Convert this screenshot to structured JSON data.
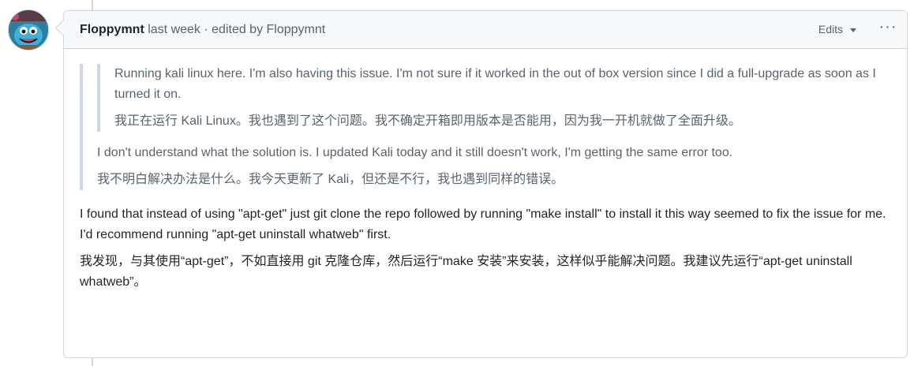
{
  "comment": {
    "author": "Floppymnt",
    "time": "last week",
    "separator": " · ",
    "edited_by_label": "edited by",
    "edited_by": "Floppymnt",
    "edits_label": "Edits",
    "more_label": "···"
  },
  "quote": {
    "nested": {
      "en": "Running kali linux here. I'm also having this issue. I'm not sure if it worked in the out of box version since I did a full-upgrade as soon as I turned it on.",
      "zh": "我正在运行 Kali Linux。我也遇到了这个问题。我不确定开箱即用版本是否能用，因为我一开机就做了全面升级。"
    },
    "en": "I don't understand what the solution is. I updated Kali today and it still doesn't work, I'm getting the same error too.",
    "zh": "我不明白解决办法是什么。我今天更新了 Kali，但还是不行，我也遇到同样的错误。"
  },
  "body": {
    "en": "I found that instead of using \"apt-get\" just git clone the repo followed by running \"make install\" to install it this way seemed to fix the issue for me. I'd recommend running \"apt-get uninstall whatweb\" first.",
    "zh": "我发现，与其使用“apt-get”，不如直接用 git 克隆仓库，然后运行“make 安装”来安装，这样似乎能解决问题。我建议先运行“apt-get uninstall whatweb”。"
  }
}
